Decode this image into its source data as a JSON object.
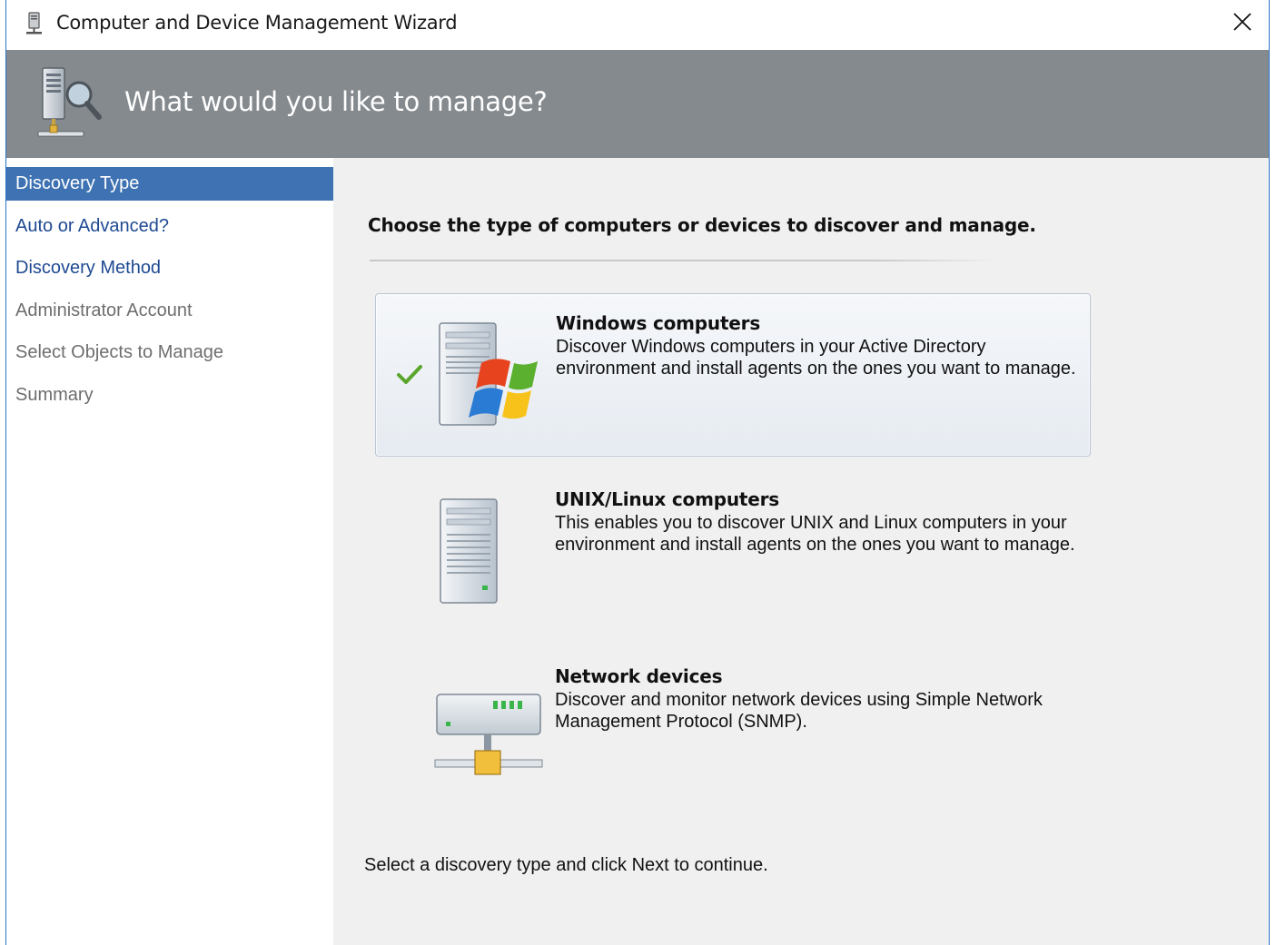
{
  "window": {
    "title": "Computer and Device Management Wizard",
    "close_symbol": "✕",
    "icons": {
      "title": "server-icon",
      "header": "server-search-icon",
      "close": "close-icon"
    }
  },
  "header": {
    "title": "What would you like to manage?"
  },
  "nav": {
    "items": [
      {
        "label": "Discovery Type",
        "state": "active"
      },
      {
        "label": "Auto or Advanced?",
        "state": "enabled"
      },
      {
        "label": "Discovery Method",
        "state": "enabled"
      },
      {
        "label": "Administrator Account",
        "state": "disabled"
      },
      {
        "label": "Select Objects to Manage",
        "state": "disabled"
      },
      {
        "label": "Summary",
        "state": "disabled"
      }
    ]
  },
  "content": {
    "instruction": "Choose the type of computers or devices to discover and manage.",
    "options": [
      {
        "title": "Windows computers",
        "description": "Discover Windows computers in your Active Directory environment and install agents on the ones you want to manage.",
        "selected": true,
        "icon": "windows-server-icon"
      },
      {
        "title": "UNIX/Linux computers",
        "description": "This enables you to discover UNIX and Linux computers in your environment and install agents on the ones you want to manage.",
        "selected": false,
        "icon": "unix-server-icon"
      },
      {
        "title": "Network devices",
        "description": "Discover and monitor network devices using Simple Network Management Protocol (SNMP).",
        "selected": false,
        "icon": "network-device-icon"
      }
    ],
    "footer": "Select a discovery type and click Next to continue."
  },
  "colors": {
    "header_band": "#858a8e",
    "nav_active_bg": "#3e72b3",
    "nav_link": "#1f4a92",
    "nav_disabled": "#6e6e6e",
    "content_bg": "#f0f0f0",
    "window_border": "#2b74c7",
    "check": "#5aa62c"
  }
}
